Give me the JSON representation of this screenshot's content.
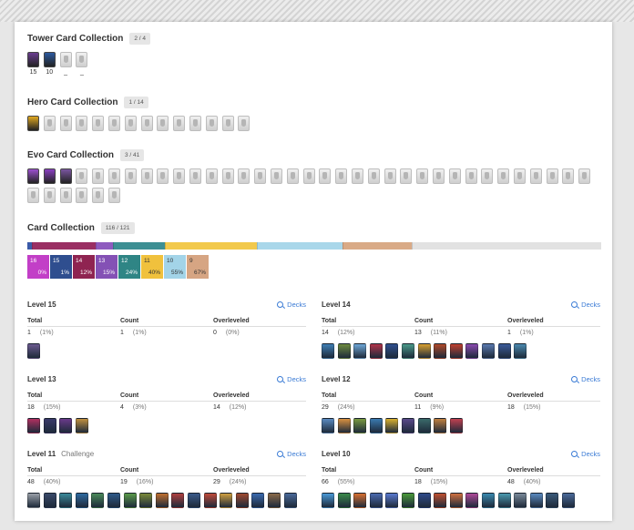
{
  "tower": {
    "title": "Tower Card Collection",
    "badge": "2 / 4",
    "labels": [
      "15",
      "10",
      "_",
      "_"
    ],
    "colors": [
      "#6a3d8f",
      "#2c5aa0"
    ],
    "grey_count": 2
  },
  "hero": {
    "title": "Hero Card Collection",
    "badge": "1 / 14",
    "colors": [
      "#e0a820"
    ],
    "grey_count": 13
  },
  "evo": {
    "title": "Evo Card Collection",
    "badge": "3 / 41",
    "colors": [
      "#9b4fcf",
      "#8a3fc2",
      "#7a55a0"
    ],
    "grey_count": 38
  },
  "collection": {
    "title": "Card Collection",
    "badge": "116 / 121",
    "bar": [
      {
        "color": "#3a5aa8",
        "fraction": 0.008
      },
      {
        "color": "#9a2f63",
        "fraction": 0.11
      },
      {
        "color": "#8e5bbf",
        "fraction": 0.03
      },
      {
        "color": "#3d8f93",
        "fraction": 0.09
      },
      {
        "color": "#f2c94c",
        "fraction": 0.16
      },
      {
        "color": "#a9d7ea",
        "fraction": 0.15
      },
      {
        "color": "#d9aa86",
        "fraction": 0.12
      },
      {
        "color": "#e2e2e2",
        "fraction": 0.332
      }
    ],
    "tiles": [
      {
        "level": "16",
        "pct": "0%",
        "color": "#c23fc7",
        "text": "#fff"
      },
      {
        "level": "15",
        "pct": "1%",
        "color": "#2f4e8f",
        "text": "#fff"
      },
      {
        "level": "14",
        "pct": "12%",
        "color": "#8f2451",
        "text": "#fff"
      },
      {
        "level": "13",
        "pct": "15%",
        "color": "#8451b5",
        "text": "#fff"
      },
      {
        "level": "12",
        "pct": "24%",
        "color": "#2f8585",
        "text": "#fff"
      },
      {
        "level": "11",
        "pct": "40%",
        "color": "#f0c13d",
        "text": "#333"
      },
      {
        "level": "10",
        "pct": "55%",
        "color": "#a3d4e8",
        "text": "#333"
      },
      {
        "level": "9",
        "pct": "67%",
        "color": "#d6a583",
        "text": "#333"
      }
    ]
  },
  "labels": {
    "decks": "Decks",
    "total": "Total",
    "count": "Count",
    "overleveled": "Overleveled"
  },
  "levels": [
    {
      "name": "Level 15",
      "sub": "",
      "total": "1",
      "total_pct": "(1%)",
      "count": "1",
      "count_pct": "(1%)",
      "over": "0",
      "over_pct": "(0%)",
      "icons": [
        "#6b5a8f"
      ]
    },
    {
      "name": "Level 14",
      "sub": "",
      "total": "14",
      "total_pct": "(12%)",
      "count": "13",
      "count_pct": "(11%)",
      "over": "1",
      "over_pct": "(1%)",
      "icons": [
        "#3f7fb5",
        "#6d8a3f",
        "#6fa8d8",
        "#b0334a",
        "#2f4f8f",
        "#4a9a8a",
        "#d8a030",
        "#b04a2a",
        "#c04030",
        "#8a4ab0",
        "#5a7ab0",
        "#3a5a9a",
        "#4a8ab0"
      ]
    },
    {
      "name": "Level 13",
      "sub": "",
      "total": "18",
      "total_pct": "(15%)",
      "count": "4",
      "count_pct": "(3%)",
      "over": "14",
      "over_pct": "(12%)",
      "icons": [
        "#b03060",
        "#3a3a6a",
        "#6a3a8a",
        "#c09040"
      ]
    },
    {
      "name": "Level 12",
      "sub": "",
      "total": "29",
      "total_pct": "(24%)",
      "count": "11",
      "count_pct": "(9%)",
      "over": "18",
      "over_pct": "(15%)",
      "icons": [
        "#5a8ac0",
        "#d89040",
        "#7a9a40",
        "#3a7ab0",
        "#d8b030",
        "#5a4a8a",
        "#3a6a6a",
        "#c08040",
        "#c04050"
      ]
    },
    {
      "name": "Level 11",
      "sub": "Challenge",
      "total": "48",
      "total_pct": "(40%)",
      "count": "19",
      "count_pct": "(16%)",
      "over": "29",
      "over_pct": "(24%)",
      "icons": [
        "#9aa0a8",
        "#3a4a6a",
        "#3a8a9a",
        "#2f6aa0",
        "#4a8a5a",
        "#2f5a8a",
        "#5a9a4a",
        "#7a8a3a",
        "#c07030",
        "#b04040",
        "#3a5a8a",
        "#c04a3a",
        "#d0a040",
        "#a04a30",
        "#3a6ab0",
        "#8a6a4a",
        "#4a6a9a"
      ]
    },
    {
      "name": "Level 10",
      "sub": "",
      "total": "66",
      "total_pct": "(55%)",
      "count": "18",
      "count_pct": "(15%)",
      "over": "48",
      "over_pct": "(40%)",
      "icons": [
        "#4a9ad8",
        "#3a8a4a",
        "#d87030",
        "#4a6ab0",
        "#5a7ad0",
        "#4a9a3a",
        "#2f4a8a",
        "#c05030",
        "#d07040",
        "#b04a9a",
        "#3a8ab0",
        "#4a9ab0",
        "#7a8a9a",
        "#5a8ac0",
        "#3a5a7a",
        "#4a6a9a"
      ]
    }
  ]
}
